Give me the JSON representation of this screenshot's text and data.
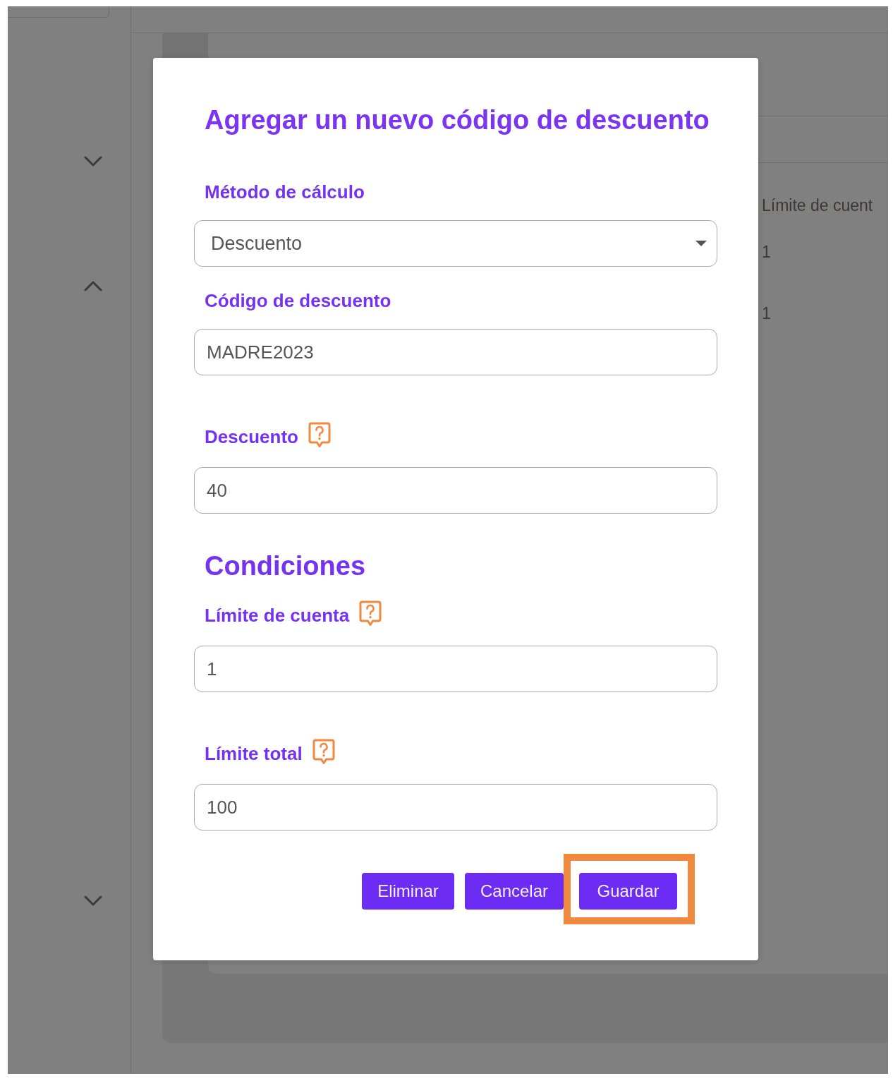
{
  "sidebar": {
    "sections": [
      {
        "expanded": false
      },
      {
        "expanded": true
      },
      {
        "expanded": false
      }
    ]
  },
  "page_behind": {
    "table": {
      "columns": [
        "Límite de cuent"
      ],
      "rows": [
        {
          "cells": [
            "1"
          ]
        },
        {
          "cells": [
            "1"
          ]
        }
      ]
    }
  },
  "dialog": {
    "title": "Agregar un nuevo código de descuento",
    "fields": [
      {
        "label": "Método de cálculo",
        "kind": "select",
        "value": "Descuento",
        "help": false
      },
      {
        "label": "Código de descuento",
        "kind": "text",
        "value": "MADRE2023",
        "help": false
      },
      {
        "label": "Descuento",
        "kind": "text",
        "value": "40",
        "help": true
      }
    ],
    "conditions": {
      "title": "Condiciones",
      "fields": [
        {
          "label": "Límite de cuenta",
          "kind": "text",
          "value": "1",
          "help": true
        },
        {
          "label": "Límite total",
          "kind": "text",
          "value": "100",
          "help": true
        }
      ]
    },
    "buttons": [
      {
        "label": "Eliminar",
        "highlighted": false
      },
      {
        "label": "Cancelar",
        "highlighted": false
      },
      {
        "label": "Guardar",
        "highlighted": true
      }
    ]
  }
}
